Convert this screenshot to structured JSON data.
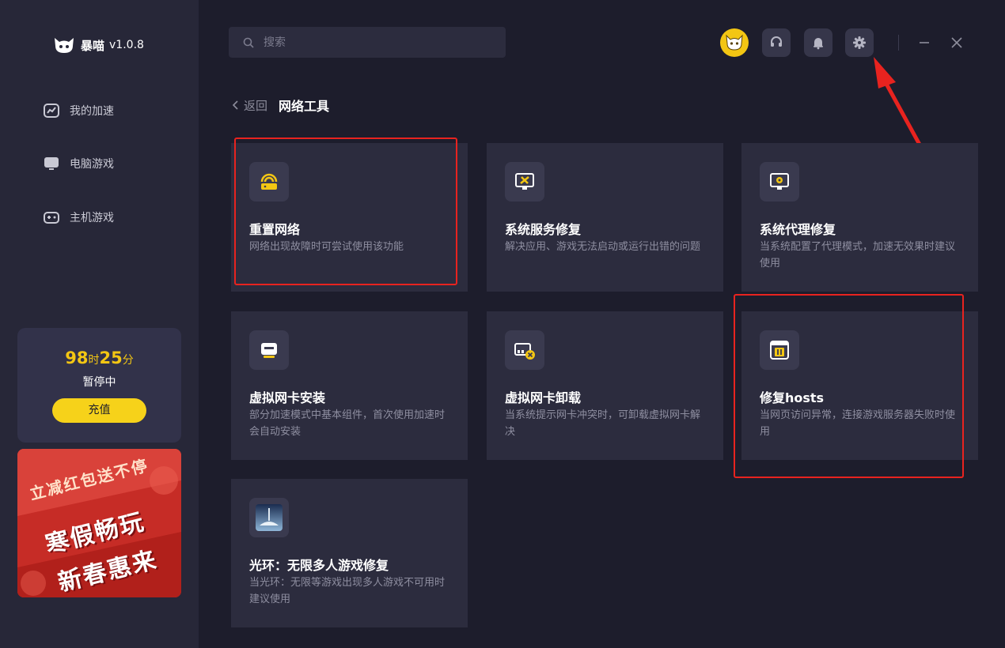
{
  "app": {
    "name": "暴喵",
    "version": "v1.0.8"
  },
  "sidebar": {
    "items": [
      {
        "label": "我的加速"
      },
      {
        "label": "电脑游戏"
      },
      {
        "label": "主机游戏"
      }
    ],
    "timer": {
      "hours": "98",
      "hours_unit": "时",
      "minutes": "25",
      "minutes_unit": "分"
    },
    "status": "暂停中",
    "recharge_label": "充值",
    "banner": {
      "line1": "立减红包送不停",
      "line2": "寒假畅玩",
      "line3": "新春惠来"
    }
  },
  "header": {
    "search_placeholder": "搜索"
  },
  "breadcrumb": {
    "back_label": "返回",
    "title": "网络工具"
  },
  "tools": [
    {
      "title": "重置网络",
      "desc": "网络出现故障时可尝试使用该功能",
      "icon": "router-icon"
    },
    {
      "title": "系统服务修复",
      "desc": "解决应用、游戏无法启动或运行出错的问题",
      "icon": "monitor-tools-icon"
    },
    {
      "title": "系统代理修复",
      "desc": "当系统配置了代理模式，加速无效果时建议使用",
      "icon": "monitor-gear-icon"
    },
    {
      "title": "虚拟网卡安装",
      "desc": "部分加速模式中基本组件，首次使用加速时会自动安装",
      "icon": "network-card-icon"
    },
    {
      "title": "虚拟网卡卸载",
      "desc": "当系统提示网卡冲突时，可卸载虚拟网卡解决",
      "icon": "network-card-remove-icon"
    },
    {
      "title": "修复hosts",
      "desc": "当网页访问异常，连接游戏服务器失败时使用",
      "icon": "browser-tools-icon"
    },
    {
      "title": "光环：无限多人游戏修复",
      "desc": "当光环：无限等游戏出现多人游戏不可用时建议使用",
      "icon": "halo-game-icon"
    }
  ],
  "colors": {
    "accent": "#f6d21a",
    "annotation": "#e8231f",
    "background": "#1d1d2c",
    "sidebar": "#272738",
    "card": "#2c2c3e"
  }
}
